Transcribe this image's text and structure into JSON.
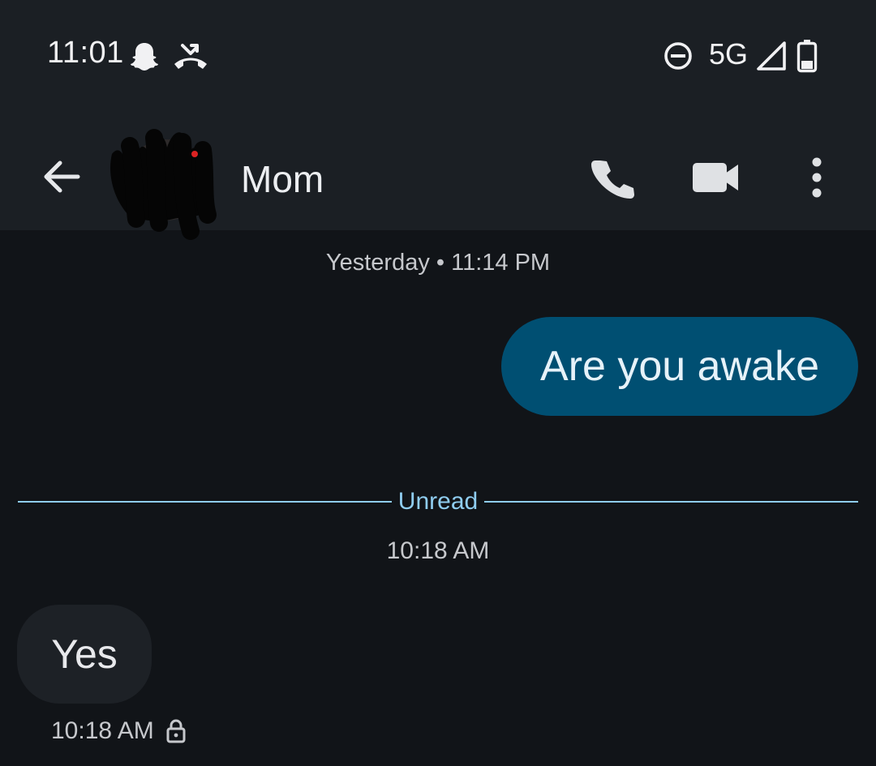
{
  "status_bar": {
    "time": "11:01",
    "network": "5G",
    "icons": [
      "snapchat-ghost-icon",
      "missed-call-icon",
      "do-not-disturb-icon",
      "signal-icon",
      "battery-icon"
    ]
  },
  "app_bar": {
    "contact_name": "Mom",
    "icons": [
      "back-arrow-icon",
      "phone-icon",
      "video-camera-icon",
      "more-vert-icon"
    ]
  },
  "conversation": {
    "day_stamp": "Yesterday • 11:14 PM",
    "outgoing_message": "Are you awake",
    "unread_label": "Unread",
    "time_stamp": "10:18 AM",
    "incoming_message": "Yes",
    "incoming_meta_time": "10:18 AM"
  },
  "colors": {
    "background": "#111418",
    "top_bar": "#1b1f24",
    "outgoing_bubble": "#004f72",
    "incoming_bubble": "#1d2126",
    "unread_accent": "#8fcdf0"
  }
}
